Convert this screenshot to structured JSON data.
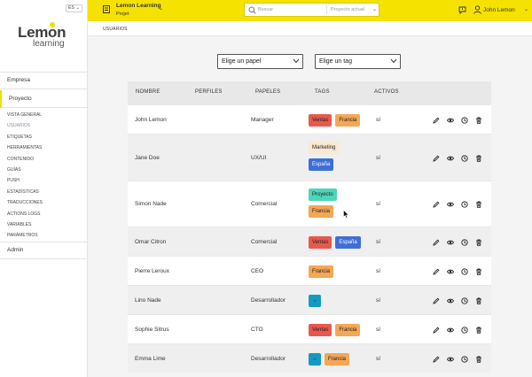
{
  "sidebar": {
    "lang": "ES",
    "logo_top": "Lemon",
    "logo_bottom": "learning",
    "empresa": "Empresa",
    "proyecto": "Proyecto",
    "subitems": [
      "Vista general",
      "Usuarios",
      "Etiquetas",
      "Herramientas",
      "Contenido",
      "Guías",
      "Push",
      "Estadísticas",
      "Traducciones",
      "Actions logs",
      "Variables",
      "Parámetros"
    ],
    "admin": "Admin"
  },
  "topbar": {
    "project_name": "Lemon Learning",
    "project_sub": "Projet",
    "search_placeholder": "Buscar",
    "search_scope": "Proyecto actual",
    "user_name": "John Lemon"
  },
  "breadcrumb": "Usuarios",
  "filters": {
    "role": "Elige un papel",
    "tag": "Elige un tag"
  },
  "table": {
    "headers": [
      "Nombre",
      "Perfiles",
      "Papeles",
      "Tags",
      "Activos"
    ],
    "rows": [
      {
        "name": "John Lemon",
        "role": "Manager",
        "tags": [
          "Ventas",
          "Francia"
        ],
        "active": "sí"
      },
      {
        "name": "Jane Doe",
        "role": "UX/UI",
        "tags": [
          "Marketing",
          "España"
        ],
        "active": "sí"
      },
      {
        "name": "Simon Nade",
        "role": "Comercial",
        "tags": [
          "Proyecto",
          "Francia"
        ],
        "active": "sí"
      },
      {
        "name": "Omar Citron",
        "role": "Comercial",
        "tags": [
          "Ventas",
          "España"
        ],
        "active": "sí"
      },
      {
        "name": "Pierre Leroux",
        "role": "CEO",
        "tags": [
          "Francia"
        ],
        "active": "sí"
      },
      {
        "name": "Lino Nade",
        "role": "Desarrollador",
        "tags": [
          "TI"
        ],
        "active": "sí"
      },
      {
        "name": "Sophie Sitrus",
        "role": "CTO",
        "tags": [
          "Ventas",
          "Francia"
        ],
        "active": "sí"
      },
      {
        "name": "Emma Lime",
        "role": "Desarrollador",
        "tags": [
          "TI",
          "Francia"
        ],
        "active": "sí"
      }
    ]
  },
  "colors": {
    "accent_yellow": "#f6e200",
    "tag_ventas": "#e8584c",
    "tag_francia": "#f4a855",
    "tag_espana": "#3e6fd6",
    "tag_marketing": "#fbe8d0",
    "tag_proyecto": "#4dd6b8",
    "tag_ti": "#149abf"
  },
  "row_actions": [
    "edit-icon",
    "view-icon",
    "history-icon",
    "delete-icon"
  ]
}
